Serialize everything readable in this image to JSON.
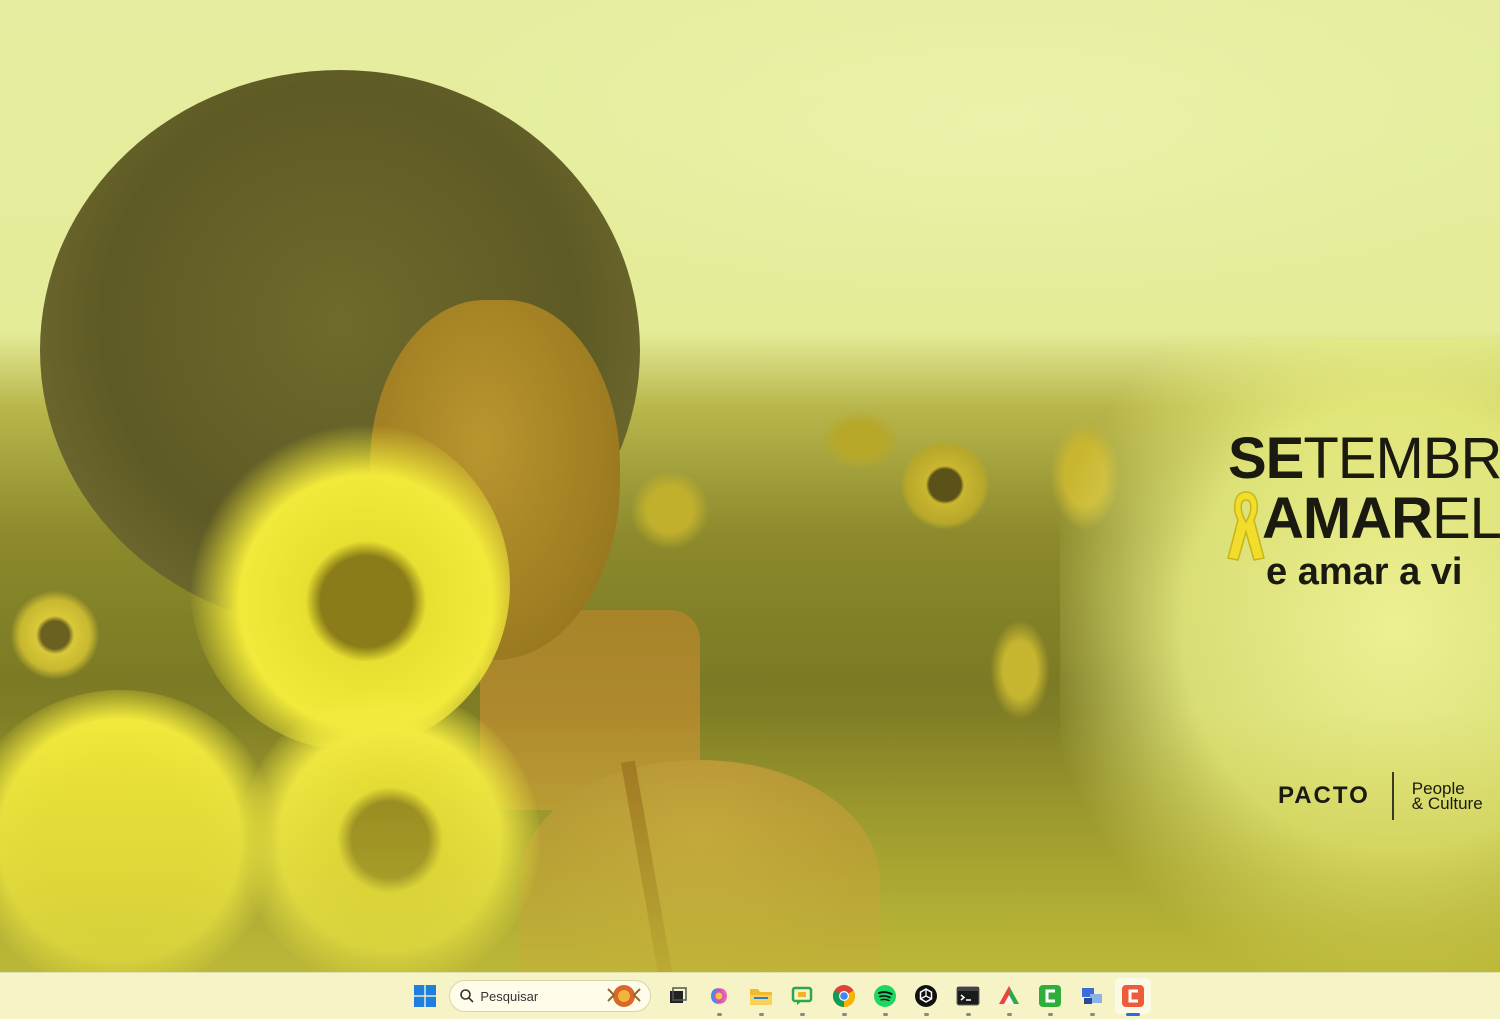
{
  "wallpaper": {
    "campaign": {
      "line1_bold": "SE",
      "line1_regular": "TEMBRO",
      "line2_bold": "AMAR",
      "line2_regular": "EL",
      "line3": "e amar a vi"
    },
    "brand": {
      "name": "PACTO",
      "sub_line1": "People",
      "sub_line2": "& Culture"
    }
  },
  "taskbar": {
    "search": {
      "placeholder": "Pesquisar"
    },
    "apps": [
      {
        "name": "task-view",
        "running": false
      },
      {
        "name": "copilot",
        "running": true
      },
      {
        "name": "file-explorer",
        "running": true
      },
      {
        "name": "chat",
        "running": true
      },
      {
        "name": "chrome",
        "running": true
      },
      {
        "name": "spotify",
        "running": true
      },
      {
        "name": "chatgpt",
        "running": true
      },
      {
        "name": "terminal",
        "running": true
      },
      {
        "name": "drawing-app",
        "running": true
      },
      {
        "name": "camtasia",
        "running": true
      },
      {
        "name": "network-tool",
        "running": true
      },
      {
        "name": "camtasia-recorder",
        "running": true,
        "active": true
      }
    ]
  },
  "colors": {
    "wallpaper_tint": "#e6eda0",
    "taskbar_bg": "#f6f3c6",
    "active_indicator": "#2a6fd6"
  }
}
